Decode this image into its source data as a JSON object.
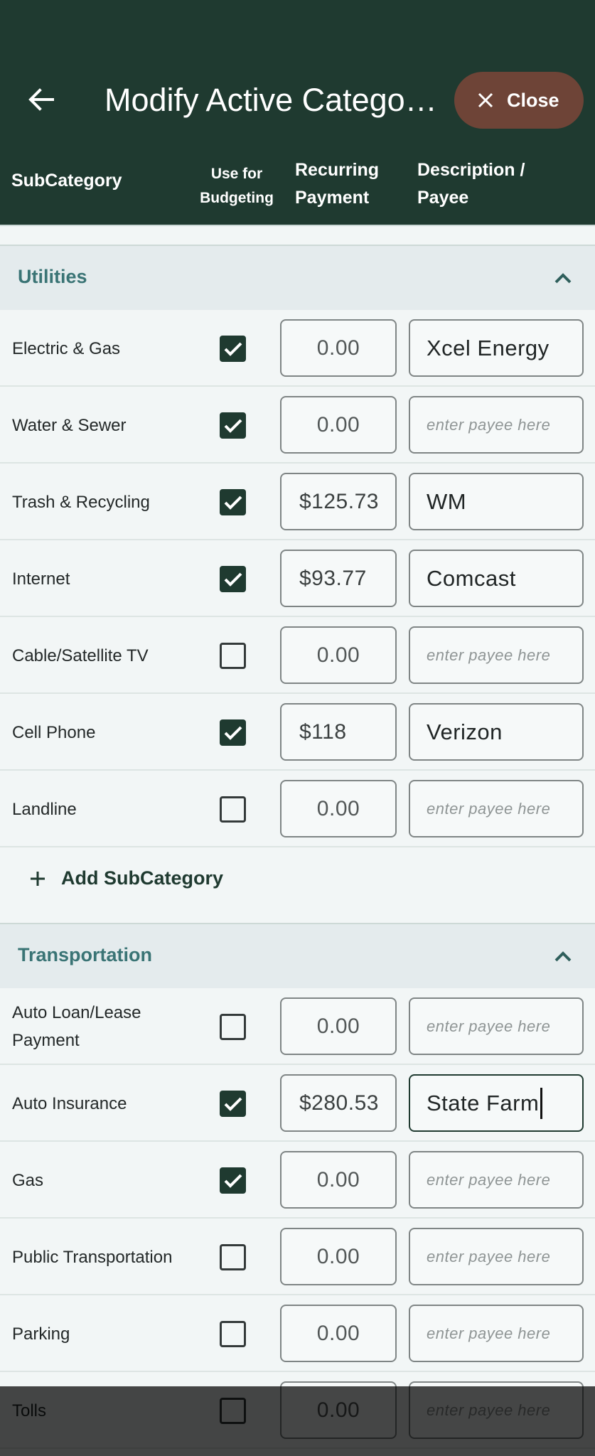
{
  "header": {
    "back_icon": "arrow-left-icon",
    "title": "Modify Active Catego…",
    "close_label": "Close",
    "close_icon": "close-icon"
  },
  "columns": {
    "subcategory": "SubCategory",
    "use_for_budgeting": "Use for Budgeting",
    "recurring_payment": "Recurring Payment",
    "description_payee": "Description / Payee"
  },
  "payee_placeholder": "enter payee here",
  "sections": [
    {
      "title": "Utilities",
      "expanded": true,
      "rows": [
        {
          "label": "Electric & Gas",
          "checked": true,
          "amount": "0.00",
          "payee": "Xcel Energy"
        },
        {
          "label": "Water & Sewer",
          "checked": true,
          "amount": "0.00",
          "payee": ""
        },
        {
          "label": "Trash & Recycling",
          "checked": true,
          "amount": "$125.73",
          "payee": "WM"
        },
        {
          "label": "Internet",
          "checked": true,
          "amount": "$93.77",
          "payee": "Comcast"
        },
        {
          "label": "Cable/Satellite TV",
          "checked": false,
          "amount": "0.00",
          "payee": ""
        },
        {
          "label": "Cell Phone",
          "checked": true,
          "amount": "$118",
          "payee": "Verizon"
        },
        {
          "label": "Landline",
          "checked": false,
          "amount": "0.00",
          "payee": ""
        }
      ],
      "add_label": "Add SubCategory"
    },
    {
      "title": "Transportation",
      "expanded": true,
      "rows": [
        {
          "label": "Auto Loan/Lease Payment",
          "checked": false,
          "amount": "0.00",
          "payee": ""
        },
        {
          "label": "Auto Insurance",
          "checked": true,
          "amount": "$280.53",
          "payee": "State Farm",
          "focused": true
        },
        {
          "label": "Gas",
          "checked": true,
          "amount": "0.00",
          "payee": ""
        },
        {
          "label": "Public Transportation",
          "checked": false,
          "amount": "0.00",
          "payee": ""
        },
        {
          "label": "Parking",
          "checked": false,
          "amount": "0.00",
          "payee": ""
        },
        {
          "label": "Tolls",
          "checked": false,
          "amount": "0.00",
          "payee": ""
        }
      ]
    }
  ],
  "colors": {
    "app_bar": "#1f3a30",
    "close_button": "#6e4437",
    "section_title": "#3a7475",
    "checkbox_checked": "#1f3a30",
    "background": "#f2f6f6"
  }
}
